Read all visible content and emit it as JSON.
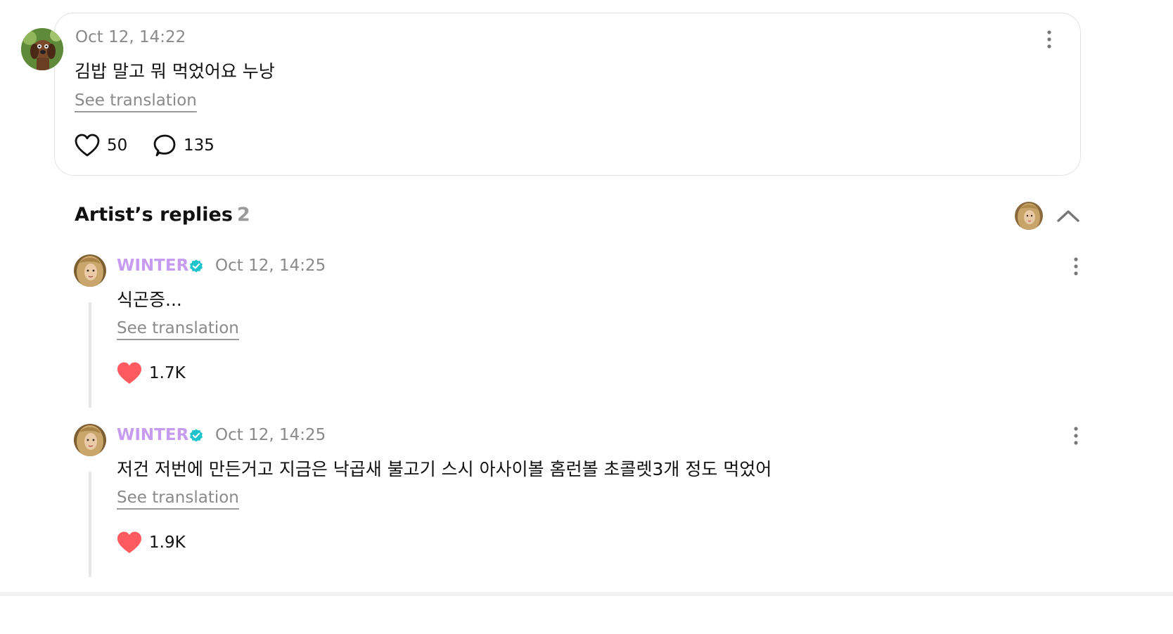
{
  "post": {
    "time": "Oct 12, 14:22",
    "text": "김밥 말고 뭐 먹었어요 누낭",
    "translate_label": "See translation",
    "likes": "50",
    "comments": "135"
  },
  "artist_replies": {
    "title": "Artist’s replies",
    "count": "2",
    "replies": [
      {
        "name": "WINTER",
        "time": "Oct 12, 14:25",
        "text": "식곤증...",
        "translate_label": "See translation",
        "likes": "1.7K"
      },
      {
        "name": "WINTER",
        "time": "Oct 12, 14:25",
        "text": "저건 저번에 만든거고 지금은 낙곱새 불고기 스시 아사이볼 홈런볼 초콜렛3개 정도 먹었어",
        "translate_label": "See translation",
        "likes": "1.9K"
      }
    ]
  },
  "colors": {
    "artist_name": "#c69bf0",
    "verified_badge": "#1fc3cc",
    "liked_heart": "#ff5a5f",
    "muted_text": "#8a8a8a"
  },
  "icons": {
    "post_like": "heart-outline-icon",
    "post_comment": "chat-bubble-icon",
    "reply_like": "heart-filled-icon",
    "verified": "verified-badge-icon",
    "more": "more-vertical-icon",
    "collapse": "chevron-up-icon"
  }
}
